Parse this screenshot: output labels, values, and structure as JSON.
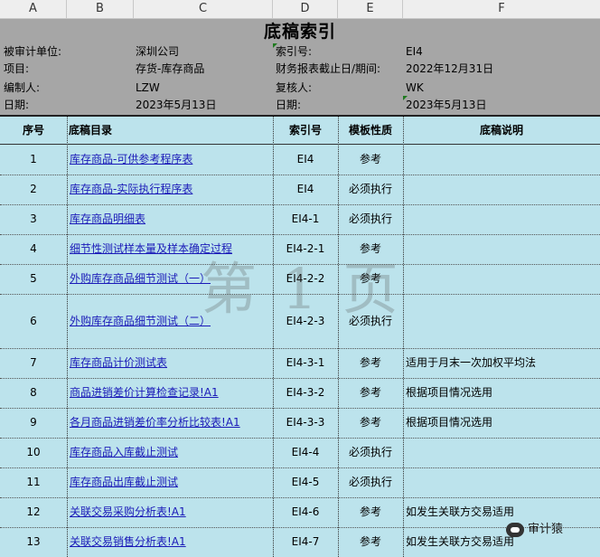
{
  "columns": [
    "A",
    "B",
    "C",
    "D",
    "E",
    "F"
  ],
  "sheet": {
    "title": "底稿索引",
    "header": {
      "audited_unit_label": "被审计单位:",
      "audited_unit_value": "深圳公司",
      "index_label": "索引号:",
      "index_value": "EI4",
      "item_label": "项目:",
      "item_value": "存货-库存商品",
      "period_label": "财务报表截止日/期间:",
      "period_value": "2022年12月31日",
      "preparer_label": "编制人:",
      "preparer_value": "LZW",
      "reviewer_label": "复核人:",
      "reviewer_value": "WK",
      "date_label": "日期:",
      "date_value": "2023年5月13日",
      "date2_label": "日期:",
      "date2_value": "2023年5月13日"
    },
    "table_headers": {
      "seq": "序号",
      "catalog": "底稿目录",
      "index": "索引号",
      "template": "模板性质",
      "note": "底稿说明"
    },
    "rows": [
      {
        "seq": "1",
        "catalog": "库存商品-可供参考程序表",
        "index": "EI4",
        "template": "参考",
        "note": ""
      },
      {
        "seq": "2",
        "catalog": "库存商品-实际执行程序表",
        "index": "EI4",
        "template": "必须执行",
        "note": ""
      },
      {
        "seq": "3",
        "catalog": "库存商品明细表",
        "index": "EI4-1",
        "template": "必须执行",
        "note": ""
      },
      {
        "seq": "4",
        "catalog": "细节性测试样本量及样本确定过程",
        "index": "EI4-2-1",
        "template": "参考",
        "note": ""
      },
      {
        "seq": "5",
        "catalog": "外购库存商品细节测试（一）",
        "index": "EI4-2-2",
        "template": "参考",
        "note": ""
      },
      {
        "seq": "6",
        "catalog": "外购库存商品细节测试（二）",
        "index": "EI4-2-3",
        "template": "必须执行",
        "note": ""
      },
      {
        "seq": "7",
        "catalog": "库存商品计价测试表",
        "index": "EI4-3-1",
        "template": "参考",
        "note": "适用于月末一次加权平均法"
      },
      {
        "seq": "8",
        "catalog": "商品进销差价计算检查记录!A1",
        "index": "EI4-3-2",
        "template": "参考",
        "note": "根据项目情况选用"
      },
      {
        "seq": "9",
        "catalog": "各月商品进销差价率分析比较表!A1",
        "index": "EI4-3-3",
        "template": "参考",
        "note": "根据项目情况选用"
      },
      {
        "seq": "10",
        "catalog": "库存商品入库截止测试",
        "index": "EI4-4",
        "template": "必须执行",
        "note": ""
      },
      {
        "seq": "11",
        "catalog": "库存商品出库截止测试",
        "index": "EI4-5",
        "template": "必须执行",
        "note": ""
      },
      {
        "seq": "12",
        "catalog": "关联交易采购分析表!A1",
        "index": "EI4-6",
        "template": "参考",
        "note": "如发生关联方交易适用"
      },
      {
        "seq": "13",
        "catalog": "关联交易销售分析表!A1",
        "index": "EI4-7",
        "template": "参考",
        "note": "如发生关联方交易适用"
      }
    ],
    "watermark": "第 1 页"
  },
  "brand": {
    "name": "审计猿",
    "icon": "wechat-icon"
  }
}
